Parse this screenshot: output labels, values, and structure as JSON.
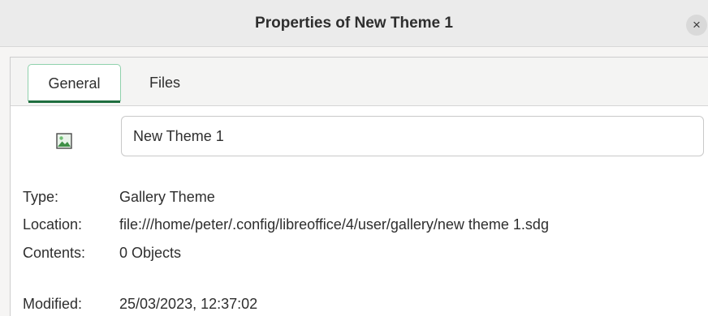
{
  "window": {
    "title": "Properties of New Theme 1",
    "close_label": "×"
  },
  "tabs": [
    {
      "label": "General",
      "active": true
    },
    {
      "label": "Files",
      "active": false
    }
  ],
  "general": {
    "icon": "image-icon",
    "name_value": "New Theme 1",
    "properties": [
      {
        "label": "Type:",
        "value": "Gallery Theme"
      },
      {
        "label": "Location:",
        "value": "file:///home/peter/.config/libreoffice/4/user/gallery/new theme 1.sdg"
      },
      {
        "label": "Contents:",
        "value": "0 Objects"
      },
      {
        "label": "Modified:",
        "value": "25/03/2023, 12:37:02"
      }
    ]
  },
  "colors": {
    "tab_active_border": "#8fd1ac",
    "tab_active_underline": "#1f6e3f"
  }
}
